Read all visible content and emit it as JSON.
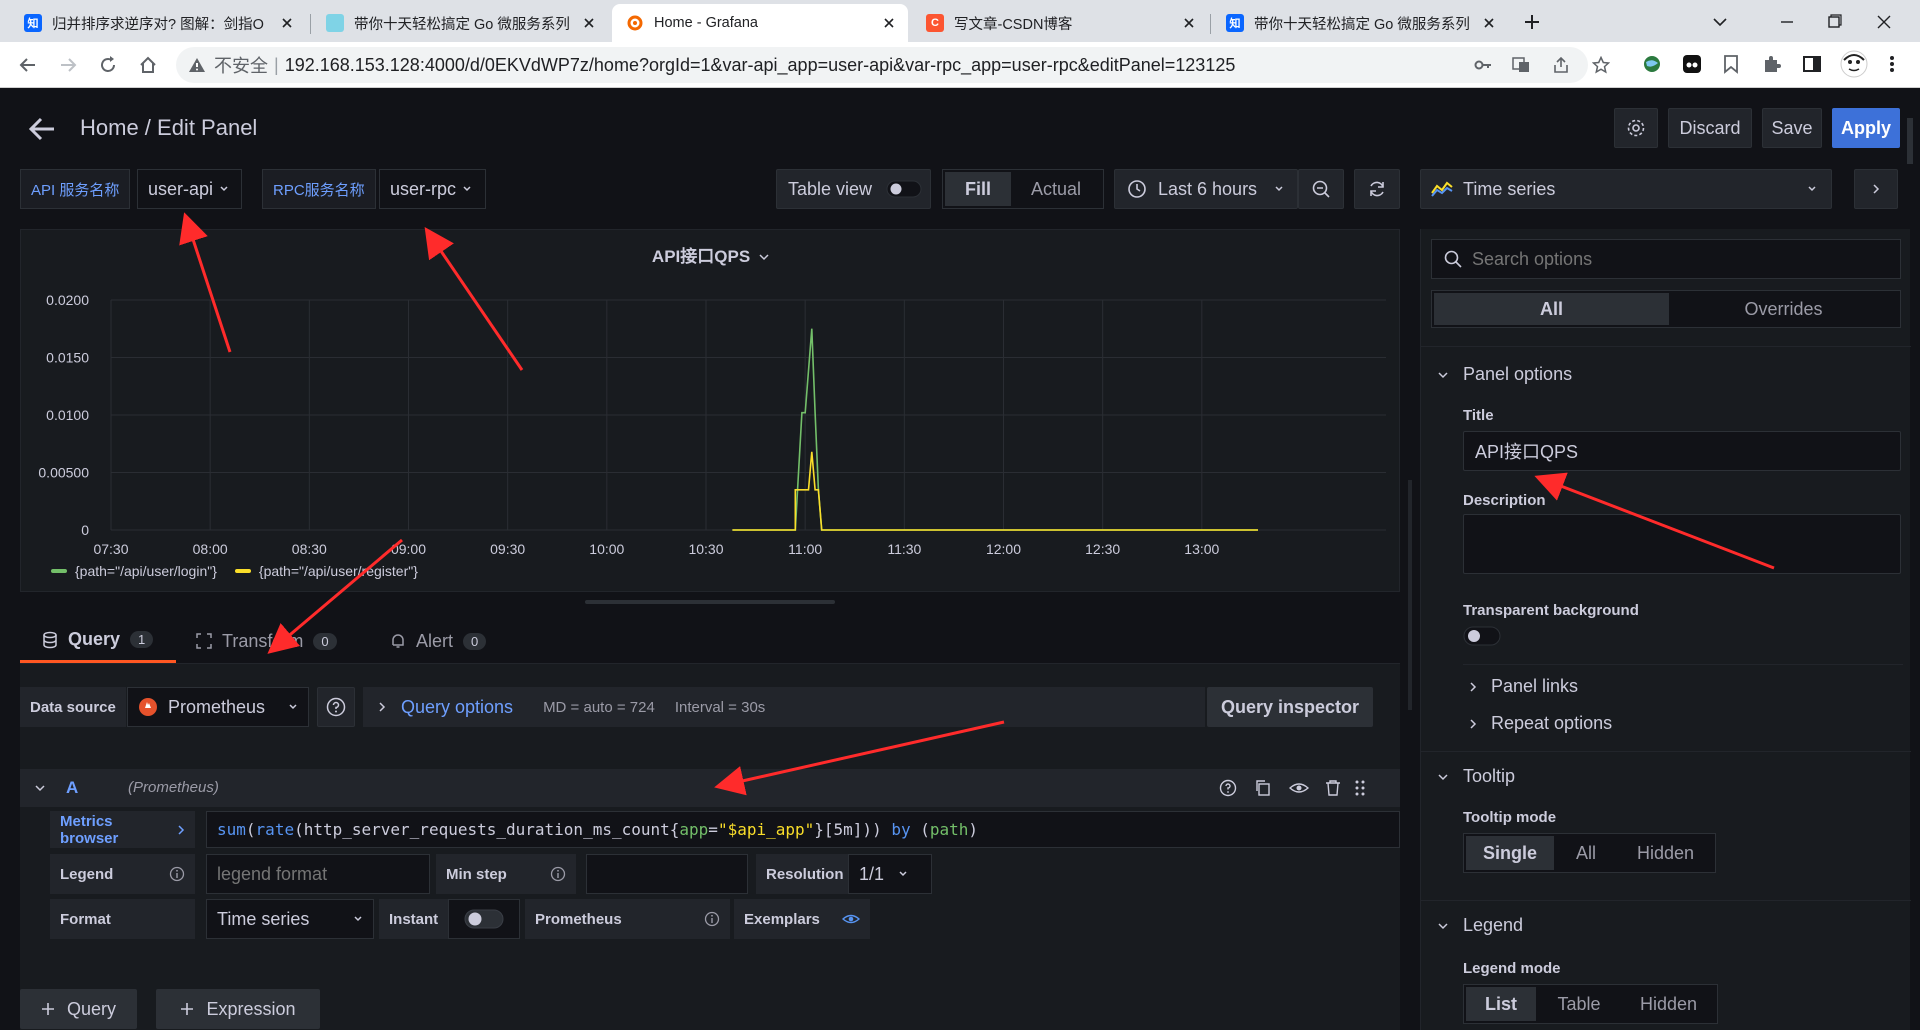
{
  "browser": {
    "tabs": [
      {
        "favicon": "知",
        "title": "归并排序求逆序对? 图解：剑指O"
      },
      {
        "favicon": "",
        "title": "带你十天轻松搞定 Go 微服务系列"
      },
      {
        "favicon": "",
        "title": "Home - Grafana"
      },
      {
        "favicon": "C",
        "title": "写文章-CSDN博客"
      },
      {
        "favicon": "知",
        "title": "带你十天轻松搞定 Go 微服务系列"
      }
    ],
    "security_label": "不安全",
    "separator": "|",
    "url": "192.168.153.128:4000/d/0EKVdWP7z/home?orgId=1&var-api_app=user-api&var-rpc_app=user-rpc&editPanel=123125"
  },
  "header": {
    "breadcrumb": "Home / Edit Panel",
    "discard": "Discard",
    "save": "Save",
    "apply": "Apply"
  },
  "variables": [
    {
      "label": "API 服务名称",
      "value": "user-api"
    },
    {
      "label": "RPC服务名称",
      "value": "user-rpc"
    }
  ],
  "toolbar": {
    "table_view": "Table view",
    "fill": "Fill",
    "actual": "Actual",
    "time_range": "Last 6 hours",
    "viz_type": "Time series"
  },
  "chart_data": {
    "type": "line",
    "title": "API接口QPS",
    "xlabel": "",
    "ylabel": "",
    "x_ticks": [
      "07:30",
      "08:00",
      "08:30",
      "09:00",
      "09:30",
      "10:00",
      "10:30",
      "11:00",
      "11:30",
      "12:00",
      "12:30",
      "13:00"
    ],
    "y_ticks": [
      "0",
      "0.00500",
      "0.0100",
      "0.0150",
      "0.0200"
    ],
    "ylim": [
      0,
      0.02
    ],
    "grid": true,
    "legend_position": "bottom-left",
    "series": [
      {
        "name": "{path=\"/api/user/login\"}",
        "color": "#73bf69",
        "points": [
          [
            "10:38",
            0
          ],
          [
            "10:57",
            0
          ],
          [
            "10:59",
            0.0102
          ],
          [
            "11:00",
            0.0102
          ],
          [
            "11:02",
            0.0175
          ],
          [
            "11:03",
            0.0102
          ],
          [
            "11:04",
            0.0035
          ],
          [
            "11:05",
            0
          ],
          [
            "13:17",
            0
          ]
        ]
      },
      {
        "name": "{path=\"/api/user/register\"}",
        "color": "#fade2a",
        "points": [
          [
            "10:38",
            0
          ],
          [
            "10:57",
            0
          ],
          [
            "10:57",
            0.0035
          ],
          [
            "11:01",
            0.0035
          ],
          [
            "11:02",
            0.0068
          ],
          [
            "11:03",
            0.0035
          ],
          [
            "11:04",
            0.0035
          ],
          [
            "11:05",
            0
          ],
          [
            "13:17",
            0
          ]
        ]
      }
    ]
  },
  "query_tabs": [
    {
      "label": "Query",
      "count": "1"
    },
    {
      "label": "Transform",
      "count": "0"
    },
    {
      "label": "Alert",
      "count": "0"
    }
  ],
  "datasource": {
    "label": "Data source",
    "value": "Prometheus",
    "query_options": "Query options",
    "md": "MD = auto = 724",
    "interval": "Interval = 30s",
    "inspector": "Query inspector"
  },
  "query": {
    "ref": "A",
    "ds_name": "(Prometheus)",
    "metrics_browser": "Metrics browser",
    "expr_parts": [
      {
        "t": "sum",
        "c": "#5794f2"
      },
      {
        "t": "(",
        "c": "#ccccdc"
      },
      {
        "t": "rate",
        "c": "#5794f2"
      },
      {
        "t": "(http_server_requests_duration_ms_count{",
        "c": "#ccccdc"
      },
      {
        "t": "app",
        "c": "#73bf69"
      },
      {
        "t": "=",
        "c": "#ccccdc"
      },
      {
        "t": "\"$api_app\"",
        "c": "#fade2a"
      },
      {
        "t": "}[5m])) ",
        "c": "#ccccdc"
      },
      {
        "t": "by",
        "c": "#5794f2"
      },
      {
        "t": " (",
        "c": "#ccccdc"
      },
      {
        "t": "path",
        "c": "#73bf69"
      },
      {
        "t": ")",
        "c": "#ccccdc"
      }
    ],
    "legend_label": "Legend",
    "legend_placeholder": "legend format",
    "min_step_label": "Min step",
    "resolution_label": "Resolution",
    "resolution_value": "1/1",
    "format_label": "Format",
    "format_value": "Time series",
    "instant_label": "Instant",
    "prometheus_label": "Prometheus",
    "exemplars_label": "Exemplars"
  },
  "add_buttons": {
    "query": "Query",
    "expression": "Expression"
  },
  "options": {
    "search_placeholder": "Search options",
    "tab_all": "All",
    "tab_overrides": "Overrides",
    "panel_options": "Panel options",
    "title_label": "Title",
    "title_value": "API接口QPS",
    "description_label": "Description",
    "transparent_label": "Transparent background",
    "panel_links": "Panel links",
    "repeat_options": "Repeat options",
    "tooltip": "Tooltip",
    "tooltip_mode": "Tooltip mode",
    "tooltip_modes": [
      "Single",
      "All",
      "Hidden"
    ],
    "legend": "Legend",
    "legend_mode": "Legend mode",
    "legend_modes": [
      "List",
      "Table",
      "Hidden"
    ]
  }
}
